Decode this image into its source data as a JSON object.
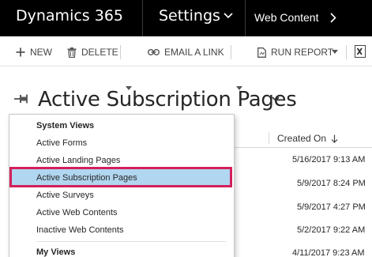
{
  "topbar": {
    "brand": "Dynamics 365",
    "area": "Settings",
    "breadcrumb": "Web Content"
  },
  "commands": {
    "new": "NEW",
    "delete": "DELETE",
    "email_link": "EMAIL A LINK",
    "run_report": "RUN REPORT"
  },
  "view": {
    "title": "Active Subscription Pages"
  },
  "grid": {
    "created_on_header": "Created On",
    "rows": [
      "5/16/2017 9:13 AM",
      "5/9/2017 8:24 PM",
      "5/9/2017 4:27 PM",
      "5/2/2017 9:22 AM",
      "4/11/2017 9:23 AM"
    ]
  },
  "view_menu": {
    "system_views_label": "System Views",
    "items": [
      "Active Forms",
      "Active Landing Pages",
      "Active Subscription Pages",
      "Active Surveys",
      "Active Web Contents",
      "Inactive Web Contents"
    ],
    "my_views_label": "My Views"
  },
  "colors": {
    "topbar_bg": "#000000",
    "selected_bg": "#b1d6f0",
    "highlight_border": "#d41f5b"
  }
}
